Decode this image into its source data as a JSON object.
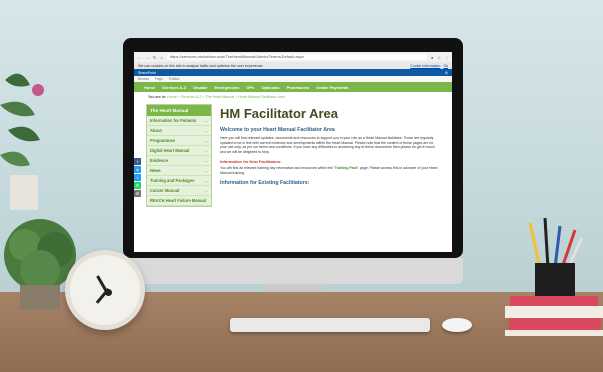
{
  "browser": {
    "url": "https://services.nhslothian.scot/TheHeartManual/Admin/Teams/Default.aspx"
  },
  "cookie_bar": {
    "text": "We use cookies on this site to analyse traffic and optimise the user experience.",
    "link": "Cookie Information",
    "ok": "Ok"
  },
  "sharepoint": {
    "brand": "SharePoint",
    "sub_items": [
      "Browse",
      "Page",
      "Publish"
    ]
  },
  "nav": {
    "items": [
      "Home",
      "Services A-Z",
      "Disable",
      "Emergencies",
      "GPs",
      "Opticians",
      "Pharmacies",
      "Online Payments"
    ]
  },
  "breadcrumb": {
    "prefix": "You are in:",
    "path": "Home > Services A-Z > The Heart Manual > Heart Manual Facilitator Area"
  },
  "sidebar": {
    "title": "The Heart Manual",
    "items": [
      {
        "label": "Information for Patients"
      },
      {
        "label": "About"
      },
      {
        "label": "Programmes"
      },
      {
        "label": "Digital Heart Manual"
      },
      {
        "label": "Evidence"
      },
      {
        "label": "News"
      },
      {
        "label": "Training and Packages"
      },
      {
        "label": "Cancer Manual"
      },
      {
        "label": "REACH Heart Failure Manual"
      }
    ]
  },
  "main": {
    "title": "HM Facilitator Area",
    "welcome": "Welcome to your Heart Manual Facilitator Area",
    "intro": "Here you will find relevant updates, documents and resources to support you in your role as a Heart Manual facilitator. These are regularly updated to be in line with current evidence and developments within the Heart Manual. Please note that the content of these pages are for your use only, as per our terms and conditions. If you have any difficulties in accessing any of these documents then please do get in touch and we will be delighted to help.",
    "new_heading": "Information for New Facilitators:",
    "new_text_prefix": "You will find all relevant training day information and resources within the",
    "new_text_link": "Training Pack",
    "new_text_suffix": "page. Please access this in advance of your Heart Manual training.",
    "existing_heading": "Information for Existing Facilitators:"
  },
  "colors": {
    "nav_green": "#7ab648",
    "title_dark": "#3f4d1f",
    "sharepoint_blue": "#0b5aa2"
  }
}
